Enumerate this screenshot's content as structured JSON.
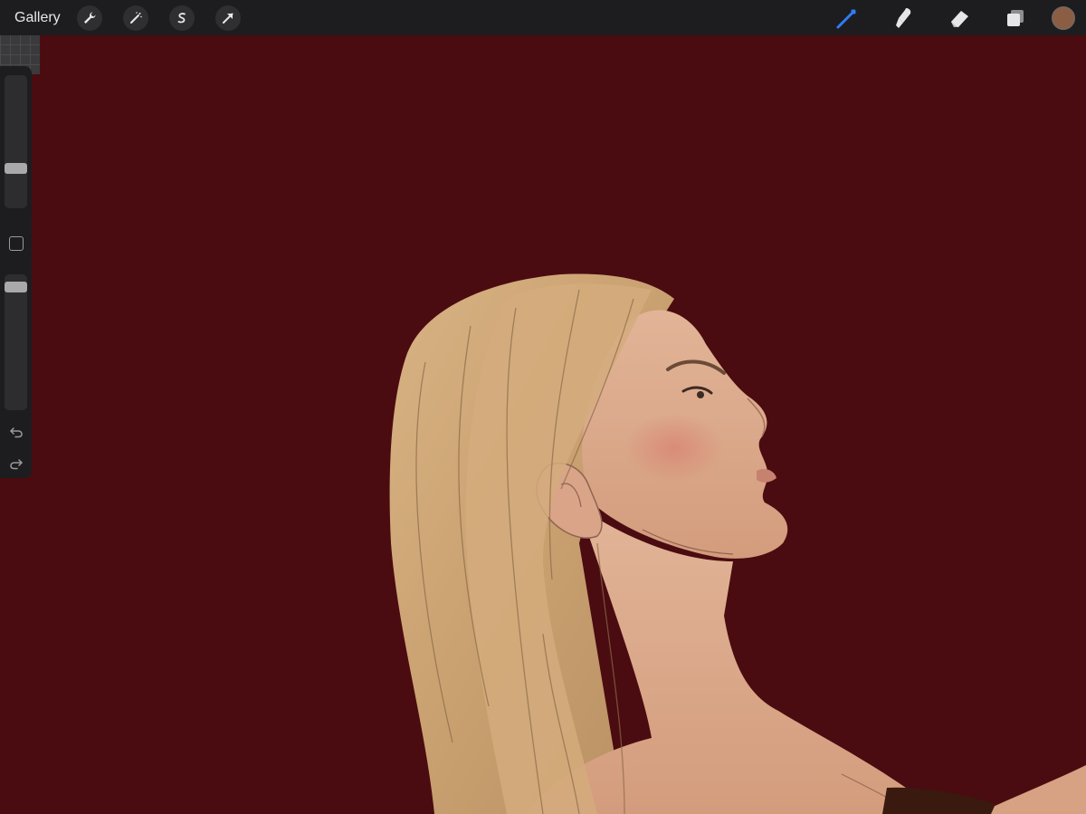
{
  "toolbar": {
    "gallery_label": "Gallery",
    "left_icons": [
      "wrench-icon",
      "magic-wand-icon",
      "selection-s-icon",
      "transform-arrow-icon"
    ],
    "right_icons": [
      "brush-icon",
      "smudge-icon",
      "eraser-icon",
      "layers-icon"
    ],
    "active_tool": "brush",
    "active_color": "#8b5e44"
  },
  "sidebar": {
    "brush_size_level": 0.28,
    "brush_opacity_level": 0.06
  },
  "colors": {
    "background": "#4a0c10",
    "toolbar": "#1d1d1f",
    "accent": "#3b82f6",
    "skin": "#d9a386",
    "hair": "#cfa77a"
  }
}
